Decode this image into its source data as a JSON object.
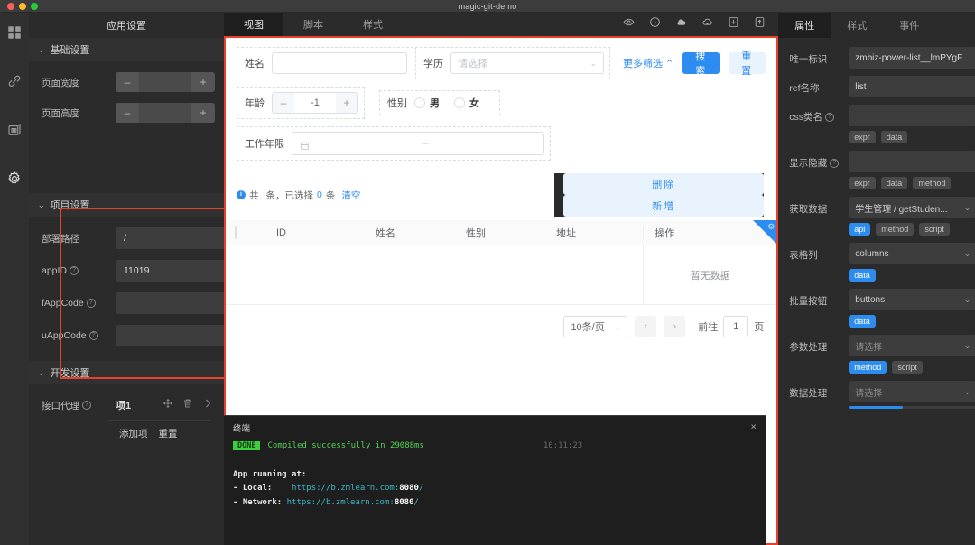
{
  "window": {
    "title": "magic-git-demo"
  },
  "rail": {
    "items": [
      {
        "name": "grid-icon",
        "label": "组件库"
      },
      {
        "name": "link-icon",
        "label": "数据源"
      },
      {
        "name": "component-icon",
        "label": "页面"
      },
      {
        "name": "gear-icon",
        "label": "设置"
      }
    ]
  },
  "left": {
    "title": "应用设置",
    "sections": [
      {
        "title": "基础设置"
      },
      {
        "title": "项目设置"
      },
      {
        "title": "开发设置"
      }
    ],
    "basic": {
      "page_width_label": "页面宽度",
      "page_width_value": "",
      "page_height_label": "页面高度",
      "page_height_value": "",
      "minus": "–",
      "plus": "+"
    },
    "project": {
      "deploy_path_label": "部署路径",
      "deploy_path_value": "/",
      "appid_label": "appID",
      "appid_value": "11019",
      "fappcode_label": "fAppCode",
      "fappcode_value": "",
      "uappcode_label": "uAppCode",
      "uappcode_value": ""
    },
    "dev": {
      "proxy_label": "接口代理",
      "item_name": "项1",
      "add_item": "添加项",
      "reset": "重置",
      "icons": [
        "move-icon",
        "trash-icon",
        "chevron-right-icon"
      ]
    }
  },
  "center": {
    "tabs": [
      {
        "label": "视图",
        "active": true
      },
      {
        "label": "脚本",
        "active": false
      },
      {
        "label": "样式",
        "active": false
      }
    ],
    "tools": [
      "eye-icon",
      "history-icon",
      "cloud-upload-icon",
      "cloud-download-icon",
      "import-icon",
      "export-icon"
    ],
    "form": {
      "name_label": "姓名",
      "name_value": "",
      "edu_label": "学历",
      "edu_placeholder": "请选择",
      "more_filter": "更多筛选",
      "search_btn": "搜 索",
      "reset_btn": "重 置",
      "age_label": "年龄",
      "age_value": "-1",
      "minus": "–",
      "plus": "+",
      "gender_label": "性别",
      "gender_options": [
        "男",
        "女"
      ],
      "work_years_label": "工作年限",
      "work_years_dash": "–"
    },
    "table": {
      "tip_total_prefix": "共",
      "tip_total": "",
      "tip_total_suffix": "条，已选择",
      "tip_selected": "0",
      "tip_selected_suffix": "条",
      "tip_clear": "清空",
      "delete_btn": "删除",
      "add_btn": "新增",
      "columns": [
        "ID",
        "姓名",
        "性别",
        "地址"
      ],
      "action_column": "操作",
      "empty_text": "暂无数据",
      "rows": []
    },
    "pager": {
      "page_size": "10条/页",
      "prev": "‹",
      "next": "›",
      "goto_label": "前往",
      "goto_value": "1",
      "page_unit": "页"
    }
  },
  "terminal": {
    "title": "终端",
    "status_badge": "DONE",
    "message": "Compiled successfully in 29088ms",
    "time": "10:11:23",
    "running_at": "App running at:",
    "local_label": "- Local:",
    "local_url": "https://b.zmlearn.com:",
    "local_port": "8080",
    "local_slash": "/",
    "network_label": "- Network:",
    "network_url": "https://b.zmlearn.com:",
    "network_port": "8080",
    "network_slash": "/",
    "close": "×"
  },
  "right": {
    "tabs": [
      {
        "label": "属性",
        "active": true
      },
      {
        "label": "样式",
        "active": false
      },
      {
        "label": "事件",
        "active": false
      }
    ],
    "props": [
      {
        "label": "唯一标识",
        "type": "input",
        "value": "zmbiz-power-list__lmPYgF",
        "help": false,
        "chips": []
      },
      {
        "label": "ref名称",
        "type": "input",
        "value": "list",
        "help": false,
        "chips": []
      },
      {
        "label": "css类名",
        "type": "input",
        "value": "",
        "help": true,
        "chips": [
          {
            "t": "expr",
            "on": false
          },
          {
            "t": "data",
            "on": false
          }
        ]
      },
      {
        "label": "显示隐藏",
        "type": "input",
        "value": "",
        "help": true,
        "chips": [
          {
            "t": "expr",
            "on": false
          },
          {
            "t": "data",
            "on": false
          },
          {
            "t": "method",
            "on": false
          }
        ]
      },
      {
        "label": "获取数据",
        "type": "select",
        "value": "学生管理 / getStuden...",
        "help": false,
        "chips": [
          {
            "t": "api",
            "on": true
          },
          {
            "t": "method",
            "on": false
          },
          {
            "t": "script",
            "on": false
          }
        ]
      },
      {
        "label": "表格列",
        "type": "select",
        "value": "columns",
        "help": false,
        "chips": [
          {
            "t": "data",
            "on": true
          }
        ]
      },
      {
        "label": "批量按钮",
        "type": "select",
        "value": "buttons",
        "help": false,
        "chips": [
          {
            "t": "data",
            "on": true
          }
        ]
      },
      {
        "label": "参数处理",
        "type": "select",
        "value": "请选择",
        "placeholder": true,
        "help": false,
        "chips": [
          {
            "t": "method",
            "on": true
          },
          {
            "t": "script",
            "on": false
          }
        ]
      },
      {
        "label": "数据处理",
        "type": "select",
        "value": "请选择",
        "placeholder": true,
        "help": false,
        "chips": []
      }
    ]
  },
  "colors": {
    "accent": "#2d8cf0",
    "highlight": "#e8402a",
    "panel_bg": "#2b2b2b",
    "terminal_bg": "#1e1e1e",
    "success": "#3ecf3e"
  }
}
